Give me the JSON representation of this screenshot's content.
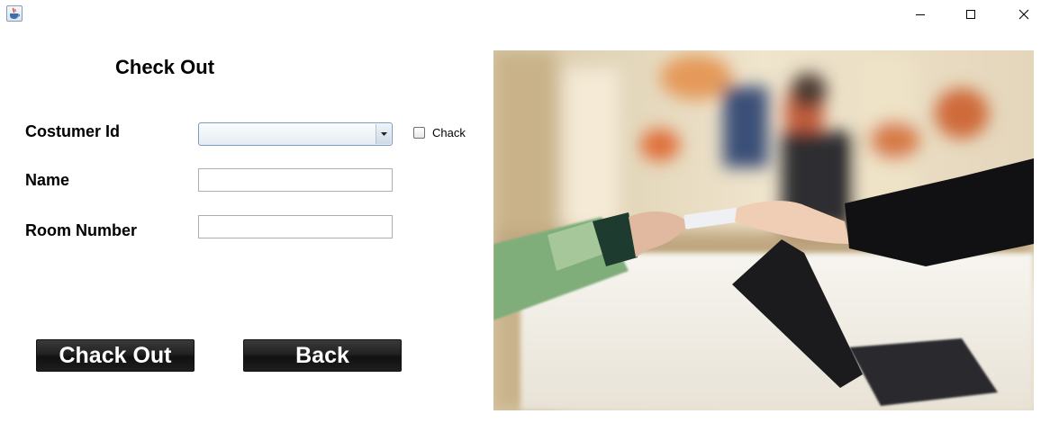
{
  "window": {
    "app_icon": "java-coffee-cup-icon",
    "controls": [
      "minimize-icon",
      "maximize-icon",
      "close-icon"
    ]
  },
  "form": {
    "title": "Check Out",
    "customer_id": {
      "label": "Costumer Id",
      "selected_value": ""
    },
    "check_label": "Chack",
    "name": {
      "label": "Name",
      "value": ""
    },
    "room_number": {
      "label": "Room Number",
      "value": ""
    }
  },
  "buttons": {
    "checkout_label": "Chack Out",
    "back_label": "Back"
  },
  "image": {
    "subject": "hotel reception card payment photo"
  }
}
